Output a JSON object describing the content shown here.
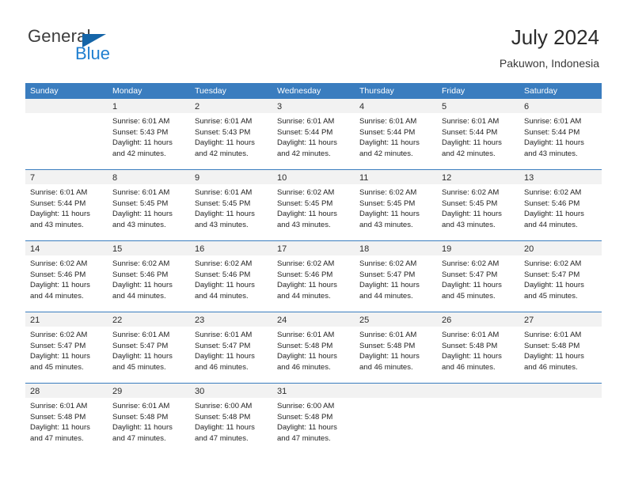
{
  "brand": {
    "word_one": "General",
    "word_two": "Blue",
    "logo_icon": "triangle-flag-icon",
    "color_blue": "#1f7fd0",
    "color_triangle": "#1565a8"
  },
  "header": {
    "title": "July 2024",
    "subtitle": "Pakuwon, Indonesia"
  },
  "theme": {
    "header_bg": "#3a7dbf",
    "header_text": "#ffffff",
    "daynum_band": "#f2f2f2",
    "row_divider": "#3a7dbf"
  },
  "weekdays": [
    "Sunday",
    "Monday",
    "Tuesday",
    "Wednesday",
    "Thursday",
    "Friday",
    "Saturday"
  ],
  "weeks": [
    [
      {
        "day": "",
        "lines": []
      },
      {
        "day": "1",
        "lines": [
          "Sunrise: 6:01 AM",
          "Sunset: 5:43 PM",
          "Daylight: 11 hours",
          "and 42 minutes."
        ]
      },
      {
        "day": "2",
        "lines": [
          "Sunrise: 6:01 AM",
          "Sunset: 5:43 PM",
          "Daylight: 11 hours",
          "and 42 minutes."
        ]
      },
      {
        "day": "3",
        "lines": [
          "Sunrise: 6:01 AM",
          "Sunset: 5:44 PM",
          "Daylight: 11 hours",
          "and 42 minutes."
        ]
      },
      {
        "day": "4",
        "lines": [
          "Sunrise: 6:01 AM",
          "Sunset: 5:44 PM",
          "Daylight: 11 hours",
          "and 42 minutes."
        ]
      },
      {
        "day": "5",
        "lines": [
          "Sunrise: 6:01 AM",
          "Sunset: 5:44 PM",
          "Daylight: 11 hours",
          "and 42 minutes."
        ]
      },
      {
        "day": "6",
        "lines": [
          "Sunrise: 6:01 AM",
          "Sunset: 5:44 PM",
          "Daylight: 11 hours",
          "and 43 minutes."
        ]
      }
    ],
    [
      {
        "day": "7",
        "lines": [
          "Sunrise: 6:01 AM",
          "Sunset: 5:44 PM",
          "Daylight: 11 hours",
          "and 43 minutes."
        ]
      },
      {
        "day": "8",
        "lines": [
          "Sunrise: 6:01 AM",
          "Sunset: 5:45 PM",
          "Daylight: 11 hours",
          "and 43 minutes."
        ]
      },
      {
        "day": "9",
        "lines": [
          "Sunrise: 6:01 AM",
          "Sunset: 5:45 PM",
          "Daylight: 11 hours",
          "and 43 minutes."
        ]
      },
      {
        "day": "10",
        "lines": [
          "Sunrise: 6:02 AM",
          "Sunset: 5:45 PM",
          "Daylight: 11 hours",
          "and 43 minutes."
        ]
      },
      {
        "day": "11",
        "lines": [
          "Sunrise: 6:02 AM",
          "Sunset: 5:45 PM",
          "Daylight: 11 hours",
          "and 43 minutes."
        ]
      },
      {
        "day": "12",
        "lines": [
          "Sunrise: 6:02 AM",
          "Sunset: 5:45 PM",
          "Daylight: 11 hours",
          "and 43 minutes."
        ]
      },
      {
        "day": "13",
        "lines": [
          "Sunrise: 6:02 AM",
          "Sunset: 5:46 PM",
          "Daylight: 11 hours",
          "and 44 minutes."
        ]
      }
    ],
    [
      {
        "day": "14",
        "lines": [
          "Sunrise: 6:02 AM",
          "Sunset: 5:46 PM",
          "Daylight: 11 hours",
          "and 44 minutes."
        ]
      },
      {
        "day": "15",
        "lines": [
          "Sunrise: 6:02 AM",
          "Sunset: 5:46 PM",
          "Daylight: 11 hours",
          "and 44 minutes."
        ]
      },
      {
        "day": "16",
        "lines": [
          "Sunrise: 6:02 AM",
          "Sunset: 5:46 PM",
          "Daylight: 11 hours",
          "and 44 minutes."
        ]
      },
      {
        "day": "17",
        "lines": [
          "Sunrise: 6:02 AM",
          "Sunset: 5:46 PM",
          "Daylight: 11 hours",
          "and 44 minutes."
        ]
      },
      {
        "day": "18",
        "lines": [
          "Sunrise: 6:02 AM",
          "Sunset: 5:47 PM",
          "Daylight: 11 hours",
          "and 44 minutes."
        ]
      },
      {
        "day": "19",
        "lines": [
          "Sunrise: 6:02 AM",
          "Sunset: 5:47 PM",
          "Daylight: 11 hours",
          "and 45 minutes."
        ]
      },
      {
        "day": "20",
        "lines": [
          "Sunrise: 6:02 AM",
          "Sunset: 5:47 PM",
          "Daylight: 11 hours",
          "and 45 minutes."
        ]
      }
    ],
    [
      {
        "day": "21",
        "lines": [
          "Sunrise: 6:02 AM",
          "Sunset: 5:47 PM",
          "Daylight: 11 hours",
          "and 45 minutes."
        ]
      },
      {
        "day": "22",
        "lines": [
          "Sunrise: 6:01 AM",
          "Sunset: 5:47 PM",
          "Daylight: 11 hours",
          "and 45 minutes."
        ]
      },
      {
        "day": "23",
        "lines": [
          "Sunrise: 6:01 AM",
          "Sunset: 5:47 PM",
          "Daylight: 11 hours",
          "and 46 minutes."
        ]
      },
      {
        "day": "24",
        "lines": [
          "Sunrise: 6:01 AM",
          "Sunset: 5:48 PM",
          "Daylight: 11 hours",
          "and 46 minutes."
        ]
      },
      {
        "day": "25",
        "lines": [
          "Sunrise: 6:01 AM",
          "Sunset: 5:48 PM",
          "Daylight: 11 hours",
          "and 46 minutes."
        ]
      },
      {
        "day": "26",
        "lines": [
          "Sunrise: 6:01 AM",
          "Sunset: 5:48 PM",
          "Daylight: 11 hours",
          "and 46 minutes."
        ]
      },
      {
        "day": "27",
        "lines": [
          "Sunrise: 6:01 AM",
          "Sunset: 5:48 PM",
          "Daylight: 11 hours",
          "and 46 minutes."
        ]
      }
    ],
    [
      {
        "day": "28",
        "lines": [
          "Sunrise: 6:01 AM",
          "Sunset: 5:48 PM",
          "Daylight: 11 hours",
          "and 47 minutes."
        ]
      },
      {
        "day": "29",
        "lines": [
          "Sunrise: 6:01 AM",
          "Sunset: 5:48 PM",
          "Daylight: 11 hours",
          "and 47 minutes."
        ]
      },
      {
        "day": "30",
        "lines": [
          "Sunrise: 6:00 AM",
          "Sunset: 5:48 PM",
          "Daylight: 11 hours",
          "and 47 minutes."
        ]
      },
      {
        "day": "31",
        "lines": [
          "Sunrise: 6:00 AM",
          "Sunset: 5:48 PM",
          "Daylight: 11 hours",
          "and 47 minutes."
        ]
      },
      {
        "day": "",
        "lines": []
      },
      {
        "day": "",
        "lines": []
      },
      {
        "day": "",
        "lines": []
      }
    ]
  ]
}
